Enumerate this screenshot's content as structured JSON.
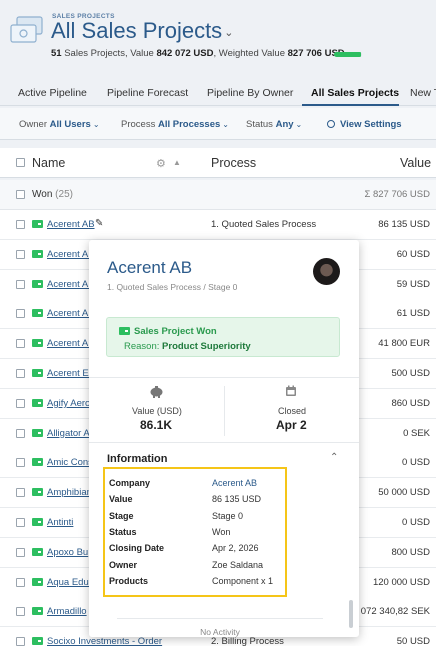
{
  "header": {
    "kicker": "SALES PROJECTS",
    "title": "All Sales Projects",
    "summary_prefix": "51",
    "summary_text1": " Sales Projects, Value ",
    "summary_value": "842 072 USD",
    "summary_text2": ", Weighted Value ",
    "summary_weighted": "827 706 USD",
    "progress_fraction": 0.98,
    "accent": "#2b5a8a",
    "success": "#2dbe60"
  },
  "tabs": [
    {
      "label": "Active Pipeline"
    },
    {
      "label": "Pipeline Forecast"
    },
    {
      "label": "Pipeline By Owner"
    },
    {
      "label": "All Sales Projects",
      "active": true
    },
    {
      "label": "New T"
    }
  ],
  "filters": {
    "owner_label": "Owner",
    "owner_value": "All Users",
    "process_label": "Process",
    "process_value": "All Processes",
    "status_label": "Status",
    "status_value": "Any",
    "view_settings": "View Settings"
  },
  "table": {
    "col_name": "Name",
    "col_process": "Process",
    "col_value": "Value",
    "group_label": "Won",
    "group_count": "(25)",
    "group_total": "Σ 827 706 USD",
    "rows": [
      {
        "name": "Acerent AB",
        "process": "1. Quoted Sales Process",
        "value": "86 135 USD"
      },
      {
        "name": "Acerent AI",
        "process": "",
        "value": "60 USD"
      },
      {
        "name": "Acerent AI",
        "process": "",
        "value": "59 USD"
      },
      {
        "name": "Acerent AI",
        "process": "",
        "value": "61 USD"
      },
      {
        "name": "Acerent AI",
        "process": "",
        "value": "41 800 EUR"
      },
      {
        "name": "Acerent El",
        "process": "",
        "value": "500 USD"
      },
      {
        "name": "Agify Aero",
        "process": "",
        "value": "860 USD"
      },
      {
        "name": "Alligator A",
        "process": "",
        "value": "0 SEK"
      },
      {
        "name": "Amic Cons",
        "process": "",
        "value": "0 USD"
      },
      {
        "name": "Amphibian",
        "process": "",
        "value": "50 000 USD"
      },
      {
        "name": "Antinti",
        "process": "",
        "value": "0 USD"
      },
      {
        "name": "Apoxo Bu",
        "process": "",
        "value": "800 USD"
      },
      {
        "name": "Aqua Educ",
        "process": "",
        "value": "120 000 USD"
      },
      {
        "name": "Armadillo",
        "process": "",
        "value": "1 072 340,82 SEK"
      },
      {
        "name": "Socixo Investments - Order",
        "process": "2. Billing Process",
        "value": "50 USD"
      }
    ]
  },
  "popup": {
    "title": "Acerent AB",
    "subtitle": "1. Quoted Sales Process  /  Stage 0",
    "won_title": "Sales Project Won",
    "won_reason_label": "Reason: ",
    "won_reason": "Product Superiority",
    "stat1_label": "Value (USD)",
    "stat1_value": "86.1K",
    "stat1_icon": "piggy-bank-icon",
    "stat2_label": "Closed",
    "stat2_value": "Apr 2",
    "stat2_icon": "calendar-icon",
    "info_heading": "Information",
    "info": [
      {
        "key": "Company",
        "value": "Acerent AB",
        "link": true
      },
      {
        "key": "Value",
        "value": "86 135 USD"
      },
      {
        "key": "Stage",
        "value": "Stage 0"
      },
      {
        "key": "Status",
        "value": "Won"
      },
      {
        "key": "Closing Date",
        "value": "Apr 2, 2026"
      },
      {
        "key": "Owner",
        "value": "Zoe Saldana"
      },
      {
        "key": "Products",
        "value": "Component x 1"
      }
    ],
    "footer": "No Activity",
    "highlight_color": "#f5c518"
  }
}
